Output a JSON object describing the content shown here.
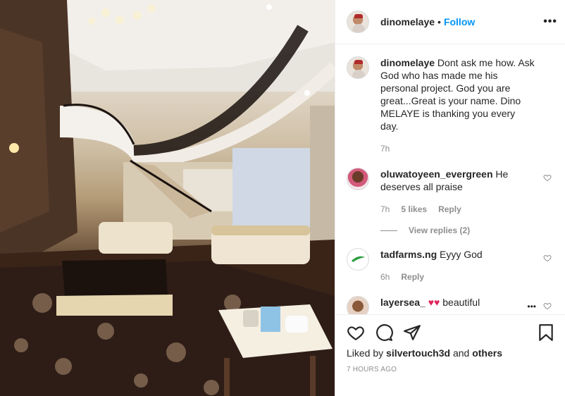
{
  "post": {
    "username": "dinomelaye",
    "separator": "•",
    "follow_label": "Follow",
    "caption": "Dont ask me how. Ask God who has made me his personal project. God you are great...Great is your name. Dino MELAYE is thanking you every day.",
    "caption_time": "7h",
    "liked_prefix": "Liked by",
    "liked_user": "silvertouch3d",
    "liked_and": "and",
    "liked_others": "others",
    "timestamp": "7 HOURS AGO"
  },
  "comments": [
    {
      "username": "oluwatoyeen_evergreen",
      "text": "He deserves all praise",
      "time": "7h",
      "likes": "5 likes",
      "reply": "Reply",
      "view_replies": "View replies (2)"
    },
    {
      "username": "tadfarms.ng",
      "text": "Eyyy God",
      "time": "6h",
      "reply": "Reply"
    },
    {
      "username": "layersea_",
      "text": "beautiful"
    }
  ],
  "icons": {
    "more": "more-options-icon",
    "like": "heart-icon",
    "comment": "comment-icon",
    "share": "paper-plane-icon",
    "save": "bookmark-icon"
  },
  "colors": {
    "accent": "#0095f6",
    "muted": "#8e8e8e",
    "text": "#262626",
    "heart_red": "#e0245e"
  }
}
